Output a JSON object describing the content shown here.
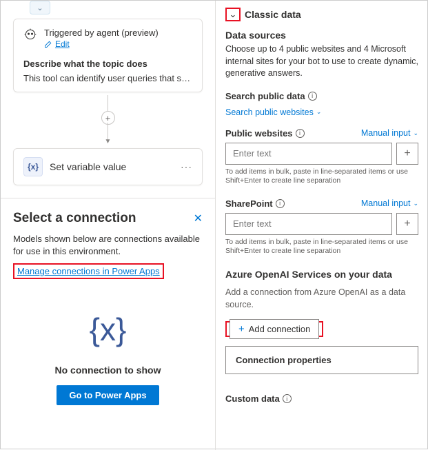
{
  "canvas": {
    "trigger": {
      "title": "Triggered by agent (preview)",
      "edit": "Edit"
    },
    "describe_label": "Describe what the topic does",
    "describe_text": "This tool can identify user queries that seek f...",
    "var_node": "Set variable value"
  },
  "conn": {
    "title": "Select a connection",
    "desc": "Models shown below are connections available for use in this environment.",
    "manage": "Manage connections in Power Apps",
    "empty_title": "No connection to show",
    "button": "Go to Power Apps",
    "big_icon": "{x}"
  },
  "right": {
    "classic": "Classic data",
    "ds_heading": "Data sources",
    "ds_text": "Choose up to 4 public websites and 4 Microsoft internal sites for your bot to use to create dynamic, generative answers.",
    "search_label": "Search public data",
    "search_link": "Search public websites",
    "pw_label": "Public websites",
    "manual": "Manual input",
    "placeholder": "Enter text",
    "hint": "To add items in bulk, paste in line-separated items or use Shift+Enter to create line separation",
    "sp_label": "SharePoint",
    "aoai_heading": "Azure OpenAI Services on your data",
    "aoai_text": "Add a connection from Azure OpenAI as a data source.",
    "add_conn": "Add connection",
    "conn_props": "Connection properties",
    "custom_label": "Custom data"
  }
}
